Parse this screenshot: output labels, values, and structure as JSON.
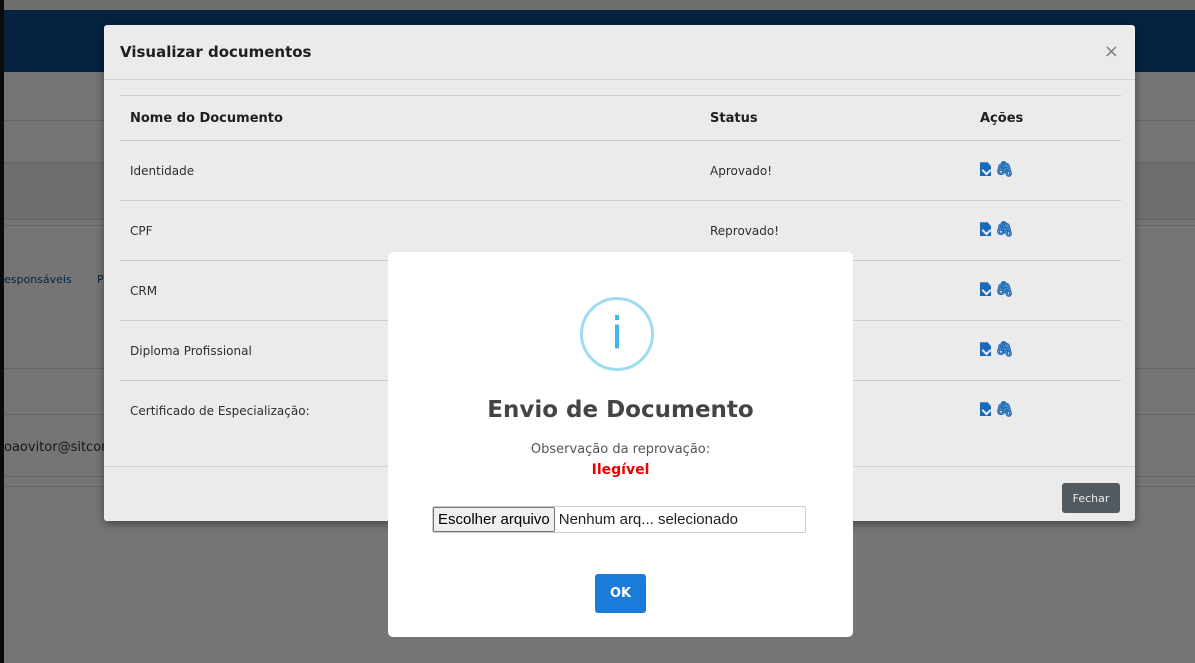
{
  "background": {
    "link_responsaveis": "esponsáveis",
    "link_p": "P",
    "email": "oaovitor@sitcor"
  },
  "modal": {
    "title": "Visualizar documentos",
    "close_label": "×",
    "columns": [
      "Nome do Documento",
      "Status",
      "Ações"
    ],
    "rows": [
      {
        "name": "Identidade",
        "status": "Aprovado!",
        "status_type": "approved"
      },
      {
        "name": "CPF",
        "status": "Reprovado!",
        "status_type": "rejected"
      },
      {
        "name": "CRM",
        "status": "",
        "status_type": ""
      },
      {
        "name": "Diploma Profissional",
        "status": "",
        "status_type": ""
      },
      {
        "name": "Certificado de Especialização:",
        "status": "",
        "status_type": ""
      }
    ],
    "action_icons": [
      "file-download-icon",
      "paperclip-icon"
    ],
    "close_button": "Fechar"
  },
  "alert": {
    "icon": "info-icon",
    "icon_glyph": "i",
    "title": "Envio de Documento",
    "observation_label": "Observação da reprovação:",
    "reason": "Ilegível",
    "file_button": "Escolher arquivo",
    "file_status": "Nenhum arq... selecionado",
    "ok_button": "OK"
  },
  "colors": {
    "header": "#0d4b8e",
    "approved": "#2e8b37",
    "rejected": "#c0392b",
    "reason": "#ee0000",
    "ok_button": "#1a7bd8",
    "fechar_button": "#5a6268",
    "info_icon": "#3fb8e5"
  }
}
